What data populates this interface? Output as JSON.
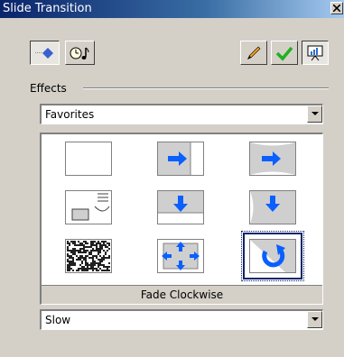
{
  "window": {
    "title": "Slide Transition"
  },
  "toolbar": {
    "left_buttons": [
      {
        "icon": "transition-effect-icon",
        "pressed": true
      },
      {
        "icon": "timing-sound-icon",
        "pressed": false
      }
    ],
    "right_buttons": [
      {
        "icon": "pencil-icon",
        "pressed": false
      },
      {
        "icon": "checkmark-icon",
        "pressed": false
      },
      {
        "icon": "presentation-icon",
        "pressed": true
      }
    ]
  },
  "effects": {
    "label": "Effects",
    "category": "Favorites",
    "transitions": [
      {
        "icon": "no-transition-icon"
      },
      {
        "icon": "push-right-icon"
      },
      {
        "icon": "cover-right-curved-icon"
      },
      {
        "icon": "roll-out-icon"
      },
      {
        "icon": "push-down-icon"
      },
      {
        "icon": "cover-down-curved-icon"
      },
      {
        "icon": "dissolve-icon"
      },
      {
        "icon": "fly-out-icon"
      },
      {
        "icon": "fade-clockwise-icon",
        "selected": true
      }
    ],
    "selected_name": "Fade Clockwise"
  },
  "speed": {
    "value": "Slow"
  },
  "colors": {
    "titlebar": "#0a246a",
    "arrow": "#0a5fff",
    "selection": "#0a246a"
  }
}
